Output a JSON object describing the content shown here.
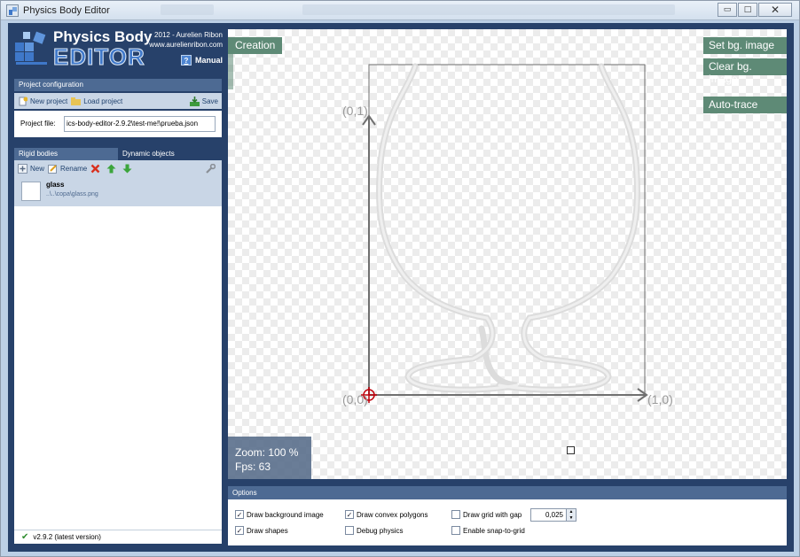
{
  "window": {
    "title": "Physics Body Editor",
    "buttons": {
      "minimize": "▭",
      "maximize": "□",
      "close": "✕"
    }
  },
  "logo": {
    "title": "Physics Body",
    "subtitle": "EDITOR",
    "credit_line1": "2012 - Aurelien Ribon",
    "credit_line2": "www.aurelienribon.com",
    "manual_label": "Manual",
    "manual_icon": "?"
  },
  "project_config": {
    "header": "Project configuration",
    "new_label": "New project",
    "load_label": "Load project",
    "save_label": "Save",
    "file_label": "Project file:",
    "file_value": "ics-body-editor-2.9.2\\test-me!\\prueba.json"
  },
  "tabs": {
    "rigid": "Rigid bodies",
    "dynamic": "Dynamic objects"
  },
  "bodies_toolbar": {
    "new_label": "New",
    "rename_label": "Rename"
  },
  "bodies": [
    {
      "name": "glass",
      "path": "..\\..\\copa\\glass.png"
    }
  ],
  "version": "v2.9.2 (latest version)",
  "canvas": {
    "mode": "Creation",
    "set_bg": "Set bg. image",
    "clear_bg": "Clear bg. image",
    "auto_trace": "Auto-trace",
    "zoom": "Zoom: 100 %",
    "fps": "Fps: 63",
    "label_origin": "(0,0)",
    "label_y": "(0,1)",
    "label_x": "(1,0)"
  },
  "options": {
    "header": "Options",
    "draw_bg": {
      "label": "Draw background image",
      "checked": true
    },
    "draw_shapes": {
      "label": "Draw shapes",
      "checked": true
    },
    "draw_convex": {
      "label": "Draw convex polygons",
      "checked": true
    },
    "debug_physics": {
      "label": "Debug physics",
      "checked": false
    },
    "draw_grid": {
      "label": "Draw grid with gap",
      "checked": false
    },
    "snap_grid": {
      "label": "Enable snap-to-grid",
      "checked": false
    },
    "grid_gap": "0,025"
  },
  "colors": {
    "frame": "#27416a",
    "section_header": "#4d6a93",
    "canvas_button": "#5e8a76",
    "axis": "#6b6b6b",
    "origin_marker": "#c0000a"
  }
}
